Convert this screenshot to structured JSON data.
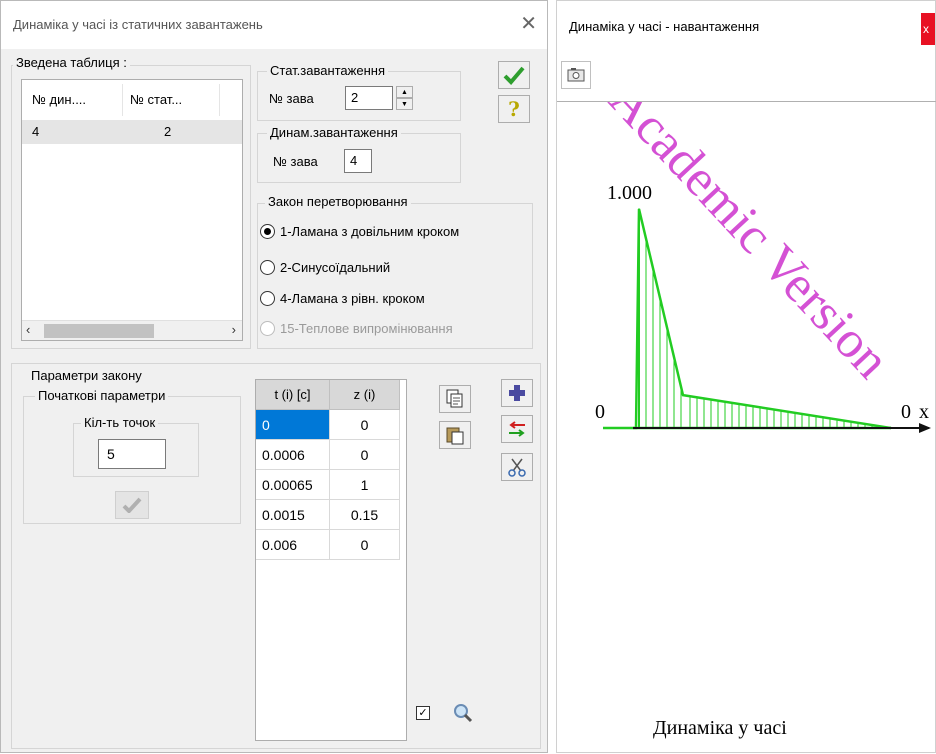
{
  "dialog": {
    "title": "Динаміка у часі із статичних завантажень",
    "summary": {
      "label": "Зведена таблиця :",
      "columns": [
        "№ дин....",
        "№ стат..."
      ],
      "rows": [
        [
          "4",
          "2"
        ]
      ]
    },
    "stat_group": {
      "label": "Стат.завантаження",
      "field_label": "№ зава",
      "value": "2"
    },
    "dyn_group": {
      "label": "Динам.завантаження",
      "field_label": "№ зава",
      "value": "4"
    },
    "law_group": {
      "label": "Закон перетворювання",
      "options": [
        {
          "label": "1-Ламана з довільним кроком",
          "selected": true,
          "disabled": false
        },
        {
          "label": "2-Синусоїдальний",
          "selected": false,
          "disabled": false
        },
        {
          "label": "4-Ламана з рівн. кроком",
          "selected": false,
          "disabled": false
        },
        {
          "label": "15-Теплове випромінювання",
          "selected": false,
          "disabled": true
        }
      ]
    },
    "params": {
      "label": "Параметри закону",
      "initial_label": "Початкові параметри",
      "points_label": "Кіл-ть точок",
      "points_value": "5"
    },
    "grid": {
      "columns": [
        "t (i) [c]",
        "z (i)"
      ],
      "rows": [
        [
          "0",
          "0"
        ],
        [
          "0.0006",
          "0"
        ],
        [
          "0.00065",
          "1"
        ],
        [
          "0.0015",
          "0.15"
        ],
        [
          "0.006",
          "0"
        ]
      ],
      "selected_row": 0
    },
    "colors": {
      "accept": "#2e9e2e",
      "help": "#b8a800",
      "selection": "#0078d7",
      "plus": "#4a4aa0"
    }
  },
  "chart_window": {
    "title": "Динаміка у часі - навантаження",
    "close_label": "x",
    "watermark": "Academic Version",
    "footer": "Динаміка у часі",
    "y_top_label": "1.000",
    "origin_label": "0",
    "end_label": "0",
    "axis_tail": "x",
    "chart_data": {
      "type": "line",
      "x": [
        0,
        0.0006,
        0.00065,
        0.0015,
        0.006
      ],
      "y": [
        0,
        0,
        1,
        0.15,
        0
      ],
      "ylim": [
        0,
        1
      ],
      "xlim": [
        0,
        0.006
      ],
      "color": "#22cc22",
      "fill": "vertical-hatch"
    }
  }
}
